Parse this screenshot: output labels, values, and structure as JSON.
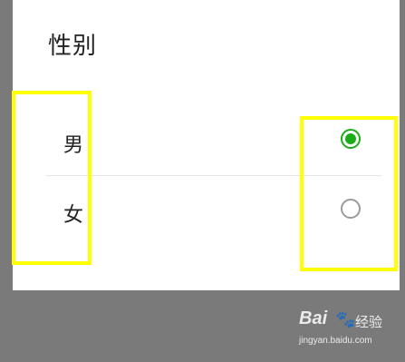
{
  "dialog": {
    "title": "性别",
    "options": [
      {
        "label": "男",
        "selected": true
      },
      {
        "label": "女",
        "selected": false
      }
    ]
  },
  "colors": {
    "accent": "#1aad19",
    "highlight": "#ffff00",
    "scrim": "#7a7a7a"
  },
  "watermark": {
    "logo": "Bai",
    "paw": "🐾",
    "jingyan": "经验",
    "url": "jingyan.baidu.com"
  }
}
